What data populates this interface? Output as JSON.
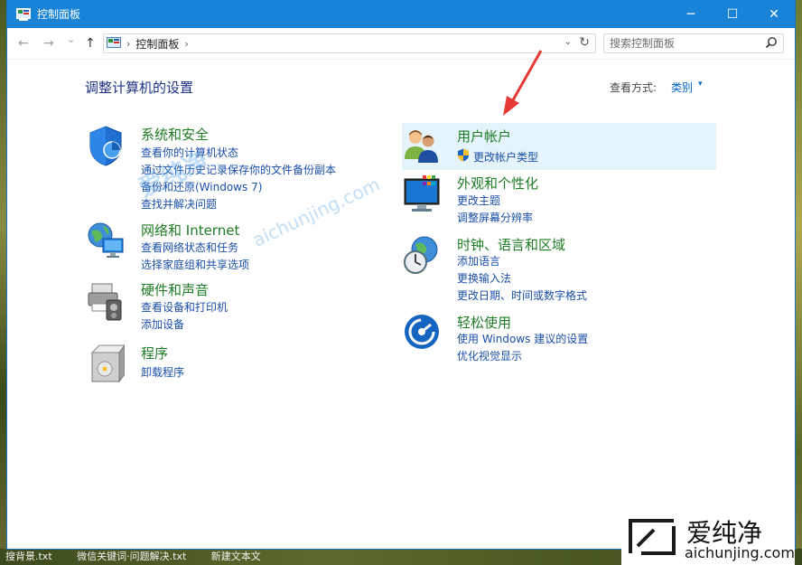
{
  "window": {
    "title": "控制面板",
    "controls": {
      "minimize": "─",
      "maximize": "☐",
      "close": "✕"
    }
  },
  "address": {
    "back": "←",
    "forward": "→",
    "recent": "⌄",
    "up": "↑",
    "separator": "›",
    "path": "控制面板",
    "dropdown": "⌄",
    "refresh": "↻",
    "search_placeholder": "搜索控制面板"
  },
  "content": {
    "heading": "调整计算机的设置",
    "view_by_label": "查看方式:",
    "view_by_value": "类别",
    "view_by_arrow": "▾"
  },
  "categories_left": [
    {
      "title": "系统和安全",
      "links": [
        "查看你的计算机状态",
        "通过文件历史记录保存你的文件备份副本",
        "备份和还原(Windows 7)",
        "查找并解决问题"
      ]
    },
    {
      "title": "网络和 Internet",
      "links": [
        "查看网络状态和任务",
        "选择家庭组和共享选项"
      ]
    },
    {
      "title": "硬件和声音",
      "links": [
        "查看设备和打印机",
        "添加设备"
      ]
    },
    {
      "title": "程序",
      "links": [
        "卸载程序"
      ]
    }
  ],
  "categories_right": [
    {
      "title": "用户帐户",
      "links": [
        "更改帐户类型"
      ]
    },
    {
      "title": "外观和个性化",
      "links": [
        "更改主题",
        "调整屏幕分辨率"
      ]
    },
    {
      "title": "时钟、语言和区域",
      "links": [
        "添加语言",
        "更换输入法",
        "更改日期、时间或数字格式"
      ]
    },
    {
      "title": "轻松使用",
      "links": [
        "使用 Windows 建议的设置",
        "优化视觉显示"
      ]
    }
  ],
  "watermark": {
    "name": "爱纯净",
    "url": "aichunjing.com"
  },
  "taskbar": [
    "搜背景.txt",
    "微信关键词·问题解决.txt",
    "新建文本文"
  ],
  "colors": {
    "titlebar": "#1883d7",
    "category_title": "#1f7b25",
    "link": "#1a4ea8",
    "heading": "#1e3287",
    "highlight": "#e5f3fb",
    "arrow": "#e53935"
  }
}
